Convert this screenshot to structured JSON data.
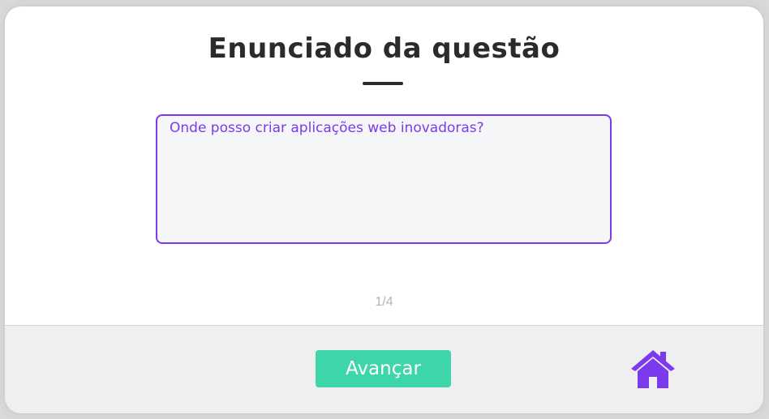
{
  "title": "Enunciado da questão",
  "question": {
    "text": "Onde posso criar aplicações web inovadoras?"
  },
  "progress": {
    "label": "1/4",
    "current": 1,
    "total": 4
  },
  "footer": {
    "next_label": "Avançar",
    "home_icon": "home-icon"
  },
  "colors": {
    "accent": "#7c3aed",
    "button": "#3dd5a9",
    "title": "#2b2b2b"
  }
}
